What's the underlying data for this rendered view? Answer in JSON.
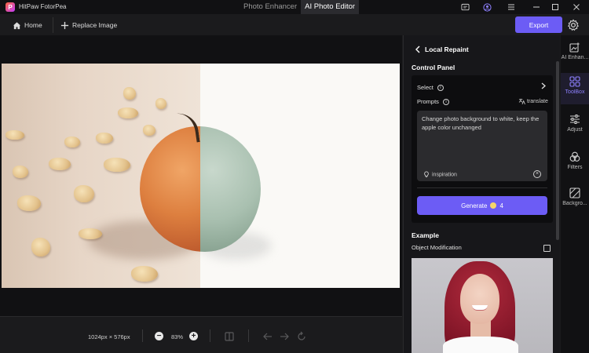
{
  "app": {
    "name": "HitPaw FotorPea",
    "logo_letter": "P"
  },
  "modes": [
    {
      "label": "Photo Enhancer",
      "active": false
    },
    {
      "label": "AI Photo Editor",
      "active": true
    }
  ],
  "toolbar": {
    "home_label": "Home",
    "replace_label": "Replace Image",
    "export_label": "Export"
  },
  "canvas": {
    "dimensions": "1024px × 576px",
    "zoom": "83%",
    "zoom_out": "−",
    "zoom_in": "+"
  },
  "panel": {
    "title": "Local Repaint",
    "control_panel_title": "Control Panel",
    "select_label": "Select",
    "prompts_label": "Prompts",
    "translate_label": "translate",
    "prompt_text": "Change photo background to white, keep the apple color unchanged",
    "inspiration_label": "inspiration",
    "generate_label": "Generate",
    "generate_cost": "4",
    "example_title": "Example",
    "example_subtitle": "Object Modification"
  },
  "rightnav": [
    {
      "label": "AI Enhan...",
      "icon": "ai-enhance-icon",
      "active": false
    },
    {
      "label": "ToolBox",
      "icon": "toolbox-icon",
      "active": true
    },
    {
      "label": "Adjust",
      "icon": "adjust-icon",
      "active": false
    },
    {
      "label": "Filters",
      "icon": "filters-icon",
      "active": false
    },
    {
      "label": "Backgro...",
      "icon": "background-icon",
      "active": false
    }
  ],
  "colors": {
    "accent": "#6c5cf5",
    "active_nav": "#8e80ff",
    "bg": "#1b1b1d"
  }
}
